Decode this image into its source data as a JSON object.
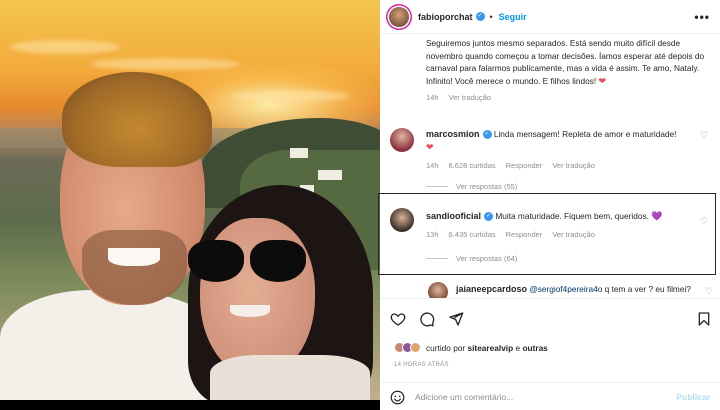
{
  "post": {
    "author": "fabioporchat",
    "follow_label": "Seguir",
    "separator": "•",
    "more_label": "•••"
  },
  "caption": {
    "text": "Seguiremos juntos mesmo separados. Está sendo muito difícil desde novembro quando começou a tomar decisões. Íamos esperar até depois do carnaval para falarmos publicamente, mas a vida é assim. Te amo, Nataly. Infinito! Você merece o mundo. E filhos lindos!",
    "heart": "❤",
    "time": "14h",
    "translate": "Ver tradução"
  },
  "comments": [
    {
      "username": "marcosmion",
      "text": "Linda mensagem! Repleta de amor e maturidade!",
      "emoji": "❤",
      "time": "14h",
      "likes": "6.628 curtidas",
      "reply": "Responder",
      "translate": "Ver tradução",
      "replies": "Ver respostas (55)"
    },
    {
      "username": "sandiooficial",
      "text": "Muita maturidade. Fiquem bem, queridos.",
      "emoji": "💜",
      "time": "13h",
      "likes": "6.435 curtidas",
      "reply": "Responder",
      "translate": "Ver tradução",
      "replies": "Ver respostas (64)"
    },
    {
      "username": "jaianeepcardoso",
      "mention": "@sergiof4pereira4o",
      "text": "q tem a ver ? eu",
      "text2": "filmei?"
    }
  ],
  "footer": {
    "liked_prefix": "curtido por",
    "liked_user": "sitearealvip",
    "liked_and": "e",
    "liked_others": "outras",
    "time_ago": "14 HORAS ATRÁS",
    "comment_placeholder": "Adicione um comentário...",
    "publish_label": "Publicar"
  },
  "colors": {
    "link_blue": "#0095f6",
    "verified": "#3897f0",
    "heart_red": "#ed4956",
    "muted": "#8e8e8e"
  }
}
